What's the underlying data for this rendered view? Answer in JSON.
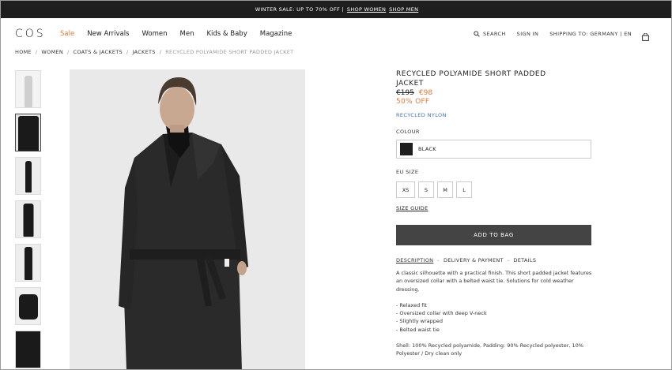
{
  "promo": {
    "text": "WINTER SALE: UP TO 70% OFF |",
    "link_women": "SHOP WOMEN",
    "link_men": "SHOP MEN"
  },
  "nav": {
    "logo": "COS",
    "links": [
      "Sale",
      "New Arrivals",
      "Women",
      "Men",
      "Kids & Baby",
      "Magazine"
    ],
    "search": "SEARCH",
    "signin": "SIGN IN",
    "shipping": "SHIPPING TO: GERMANY | EN",
    "icons": [
      "search-icon",
      "bag-icon"
    ]
  },
  "breadcrumb": [
    "HOME",
    "WOMEN",
    "COATS & JACKETS",
    "JACKETS",
    "RECYCLED POLYAMIDE SHORT PADDED JACKET"
  ],
  "breadcrumb_sep": "/",
  "product": {
    "title_line1": "RECYCLED POLYAMIDE SHORT PADDED",
    "title_line2": "JACKET",
    "old_price": "€195",
    "new_price": "€98",
    "discount": "50% OFF",
    "material": "RECYCLED NYLON",
    "colour_label": "COLOUR",
    "colour": "BLACK",
    "size_label": "EU SIZE",
    "sizes": [
      "XS",
      "S",
      "M",
      "L"
    ],
    "size_guide": "SIZE GUIDE",
    "add_to_bag": "ADD TO BAG",
    "tabs": [
      "DESCRIPTION",
      "DELIVERY & PAYMENT",
      "DETAILS"
    ],
    "tab_sep": "-",
    "description": "A classic silhouette with a practical finish. This short padded jacket features an oversized collar with a belted waist tie. Solutions for cold weather dressing.",
    "bullets": [
      "- Relaxed fit",
      "- Oversized collar with deep V-neck",
      "- Slightly wrapped",
      "- Belted waist tie"
    ],
    "composition": "Shell: 100% Recycled polyamide, Padding: 90% Recycled polyester, 10% Polyester / Dry clean only"
  },
  "colors": {
    "accent": "#e07a3a",
    "link": "#3d6fa8",
    "button": "#444444",
    "promo_bg": "#1e1e1e"
  }
}
